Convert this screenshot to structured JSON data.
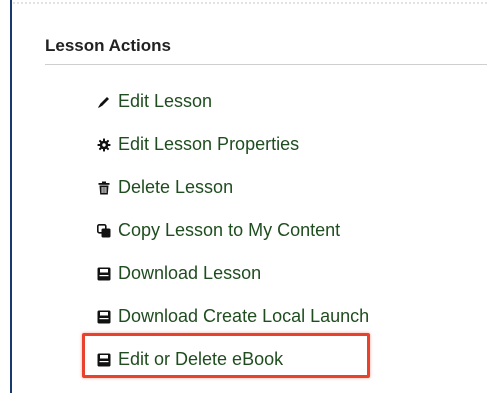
{
  "panel": {
    "heading": "Lesson Actions"
  },
  "actions": [
    {
      "label": "Edit Lesson",
      "icon": "pencil-icon"
    },
    {
      "label": "Edit Lesson Properties",
      "icon": "gear-icon"
    },
    {
      "label": "Delete Lesson",
      "icon": "trash-icon"
    },
    {
      "label": "Copy Lesson to My Content",
      "icon": "copy-icon"
    },
    {
      "label": "Download Lesson",
      "icon": "save-icon"
    },
    {
      "label": "Download Create Local Launch",
      "icon": "save-icon"
    },
    {
      "label": "Edit or Delete eBook",
      "icon": "save-icon"
    }
  ],
  "highlighted_action": "Edit or Delete eBook",
  "colors": {
    "link": "#1f4d1f",
    "heading": "#222222",
    "highlight": "#e8412c",
    "left_border": "#173a6e"
  }
}
